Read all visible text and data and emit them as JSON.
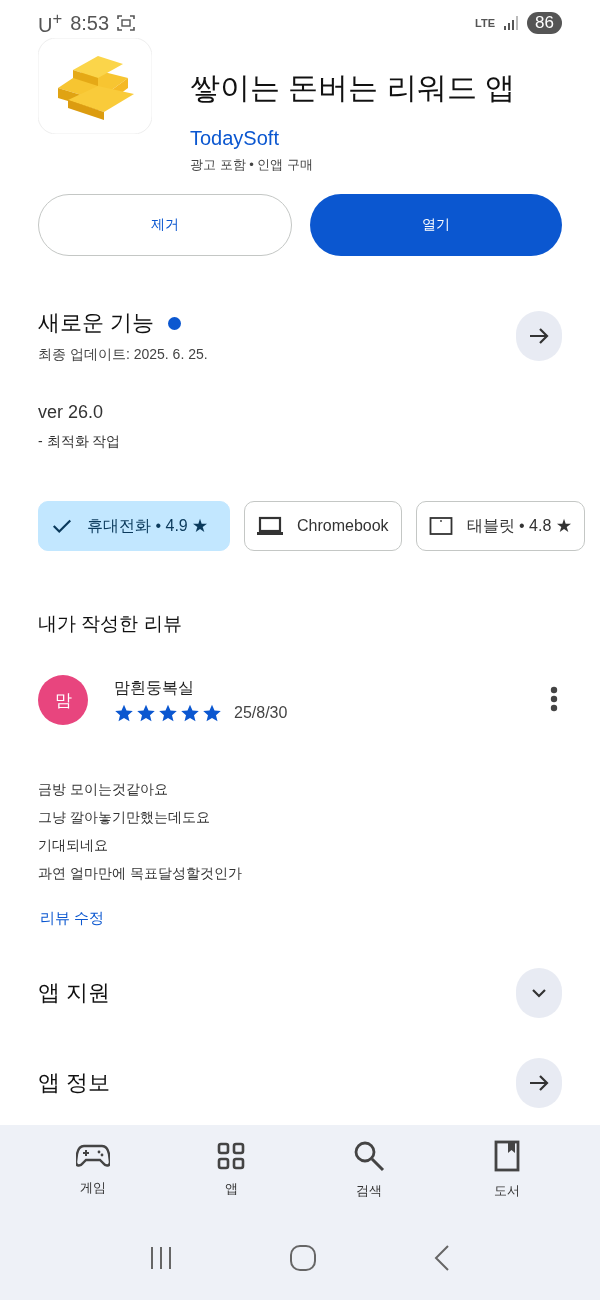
{
  "status_bar": {
    "carrier": "U$^{+}$",
    "time": "8:53",
    "network": "LTE",
    "battery": "86"
  },
  "app": {
    "title": "쌓이는 돈버는 리워드 앱",
    "developer": "TodaySoft",
    "notes": "광고 포함 • 인앱 구매"
  },
  "buttons": [
    {
      "label": "제거",
      "kind": "outline"
    },
    {
      "label": "열기",
      "kind": "filled"
    }
  ],
  "whats_new": {
    "title": "새로운 기능",
    "new_dot": true,
    "updated": "최종 업데이트: 2025. 6. 25.",
    "version": "ver 26.0",
    "notes": "- 최적화 작업"
  },
  "devices": [
    {
      "label": "휴대전화 • 4.9 ★",
      "kind": "phone",
      "selected": true
    },
    {
      "label": "Chromebook",
      "kind": "laptop",
      "selected": false
    },
    {
      "label": "태블릿 • 4.8 ★",
      "kind": "tablet",
      "selected": false
    }
  ],
  "my_review": {
    "title": "내가 작성한 리뷰",
    "avatar": "맘",
    "author": "맘흰둥복실",
    "stars": 5,
    "date": "25/8/30",
    "lines": [
      "금방 모이는것같아요",
      "그냥 깔아놓기만했는데도요",
      "기대되네요",
      "과연 얼마만에 목표달성할것인가"
    ],
    "edit": "리뷰 수정"
  },
  "sections": [
    {
      "title": "앱 지원",
      "kind": "expand"
    },
    {
      "title": "앱 정보",
      "kind": "arrow"
    }
  ],
  "bottom_nav": [
    {
      "label": "게임",
      "kind": "games"
    },
    {
      "label": "앱",
      "kind": "apps"
    },
    {
      "label": "검색",
      "kind": "search"
    },
    {
      "label": "도서",
      "kind": "books"
    }
  ]
}
